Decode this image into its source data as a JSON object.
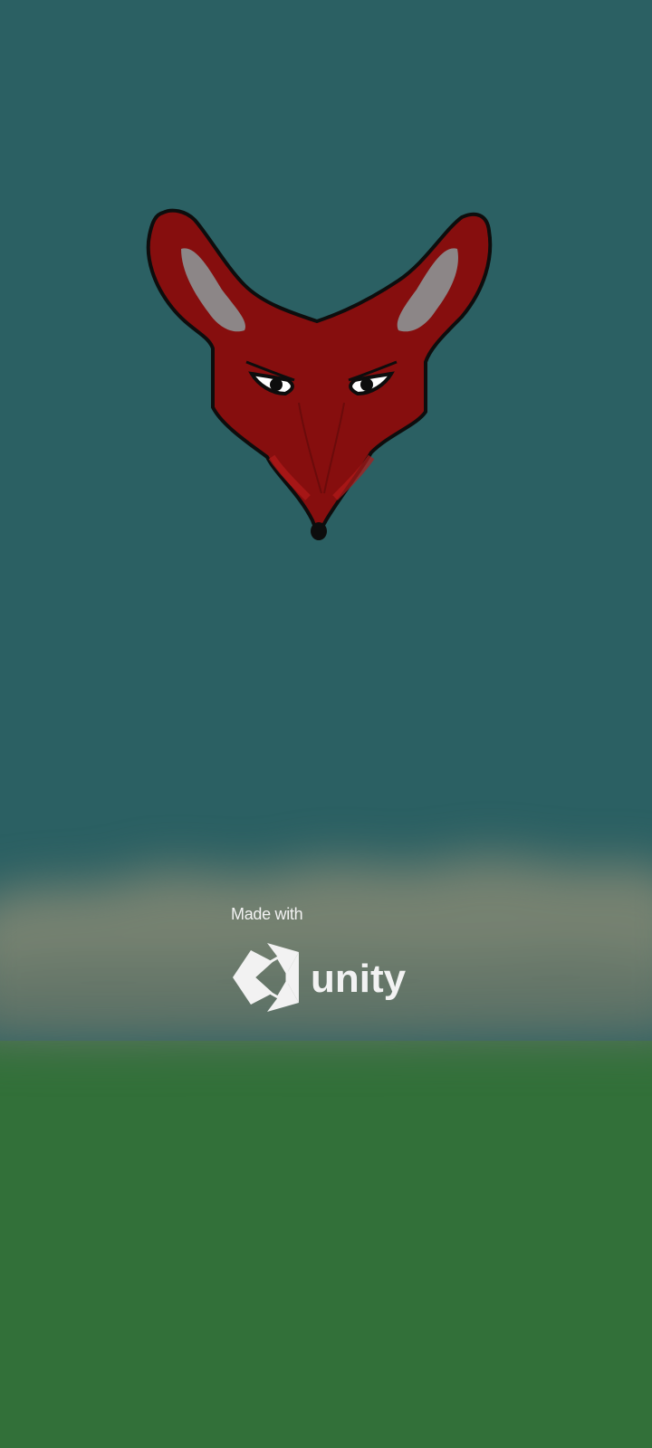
{
  "colors": {
    "sky": "#2b6063",
    "ground": "#327039",
    "haze": "#7a8472",
    "fox_fur": "#860e0e",
    "fox_outline": "#0d0d0d",
    "fox_ear_inner": "#8c8687",
    "splash_text": "#f2f2f2"
  },
  "splash": {
    "made_with": "Made with",
    "brand": "unity",
    "brand_icon": "unity-cube-icon"
  },
  "artwork": {
    "character": "red-fox-head-icon"
  }
}
